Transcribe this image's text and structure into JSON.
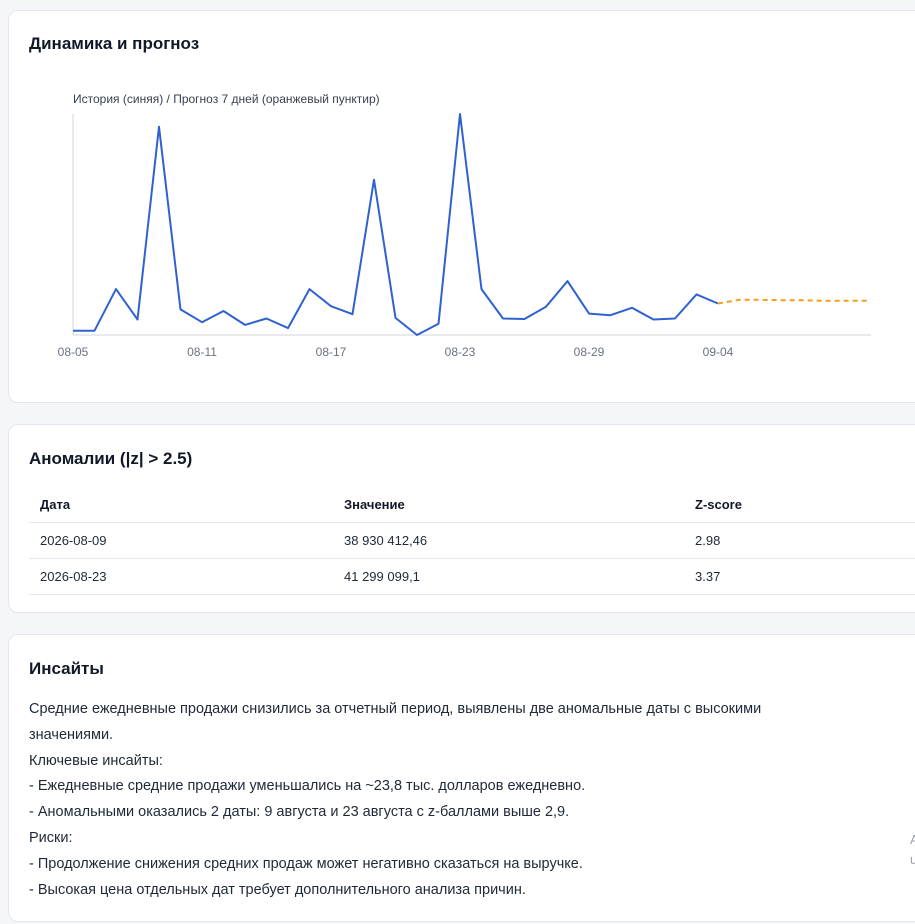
{
  "chart_card": {
    "title": "Динамика и прогноз"
  },
  "chart_data": {
    "type": "line",
    "title": "История (синяя) / Прогноз 7 дней (оранжевый пунктир)",
    "x_tick_labels": [
      "08-05",
      "08-11",
      "08-17",
      "08-23",
      "08-29",
      "09-04"
    ],
    "history": {
      "x": [
        "08-05",
        "08-06",
        "08-07",
        "08-08",
        "08-09",
        "08-10",
        "08-11",
        "08-12",
        "08-13",
        "08-14",
        "08-15",
        "08-16",
        "08-17",
        "08-18",
        "08-19",
        "08-20",
        "08-21",
        "08-22",
        "08-23",
        "08-24",
        "08-25",
        "08-26",
        "08-27",
        "08-28",
        "08-29",
        "08-30",
        "08-31",
        "09-01",
        "09-02",
        "09-03",
        "09-04"
      ],
      "values": [
        0.7,
        0.7,
        8.5,
        2.8,
        38.93,
        4.7,
        2.3,
        4.4,
        1.8,
        3.0,
        1.2,
        8.5,
        5.3,
        3.8,
        29.0,
        3.1,
        -0.1,
        2.0,
        41.3,
        8.5,
        3.0,
        2.9,
        5.2,
        10.0,
        3.9,
        3.6,
        5.0,
        2.8,
        3.0,
        7.5,
        5.8
      ]
    },
    "forecast": {
      "x": [
        "09-04",
        "09-05",
        "09-06",
        "09-07",
        "09-08",
        "09-09",
        "09-10",
        "09-11"
      ],
      "values": [
        5.8,
        6.5,
        6.5,
        6.4,
        6.4,
        6.3,
        6.3,
        6.3
      ]
    },
    "colors": {
      "history": "#2f62cf",
      "forecast": "#f0a019"
    },
    "grid": false,
    "ylim": [
      -0.1,
      41.3
    ]
  },
  "anomalies_card": {
    "title": "Аномалии (|z| > 2.5)",
    "headers": [
      "Дата",
      "Значение",
      "Z-score"
    ],
    "rows": [
      [
        "2026-08-09",
        "38 930 412,46",
        "2.98"
      ],
      [
        "2026-08-23",
        "41 299 099,1",
        "3.37"
      ]
    ]
  },
  "insights_card": {
    "title": "Инсайты",
    "lines": [
      "Средние ежедневные продажи снизились за отчетный период, выявлены две аномальные даты с высокими значениями.",
      "Ключевые инсайты:",
      "- Ежедневные средние продажи уменьшались на ~23,8 тыс. долларов ежедневно.",
      "- Аномальными оказались 2 даты: 9 августа и 23 августа с z-баллами выше 2,9.",
      "Риски:",
      "- Продолжение снижения средних продаж может негативно сказаться на выручке.",
      "- Высокая цена отдельных дат требует дополнительного анализа причин."
    ]
  },
  "edge_text": [
    "A",
    "u"
  ]
}
